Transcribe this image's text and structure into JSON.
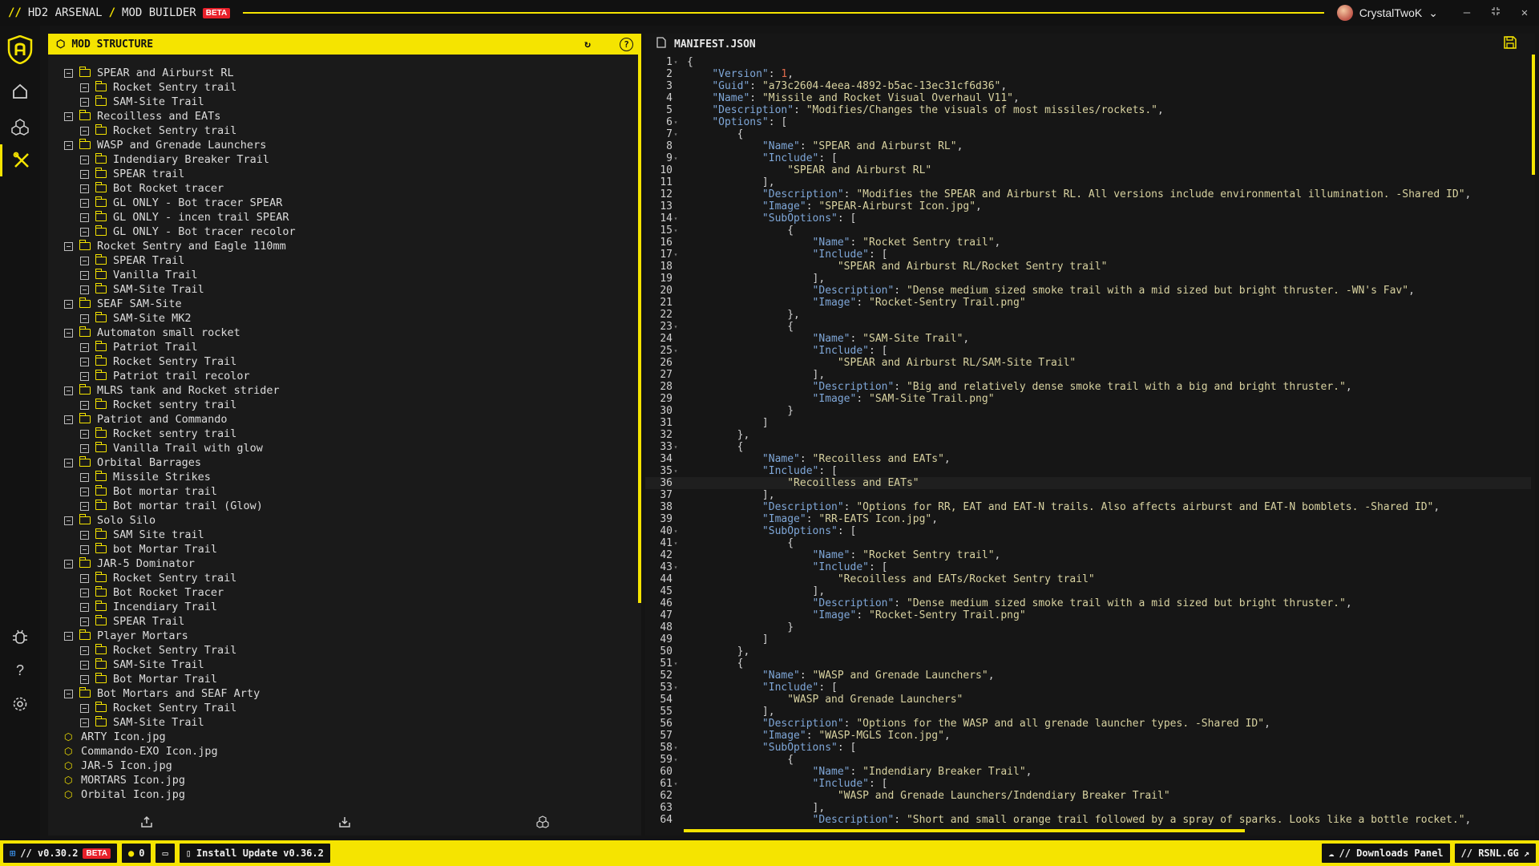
{
  "titlebar": {
    "app_name": "HD2 ARSENAL",
    "section": "MOD BUILDER",
    "beta": "BETA",
    "user": "CrystalTwoK"
  },
  "structure": {
    "title": "MOD STRUCTURE",
    "rows": [
      {
        "level": 0,
        "type": "folder",
        "label": "SPEAR and Airburst RL"
      },
      {
        "level": 1,
        "type": "item",
        "label": "Rocket Sentry trail"
      },
      {
        "level": 1,
        "type": "item",
        "label": "SAM-Site Trail"
      },
      {
        "level": 0,
        "type": "folder",
        "label": "Recoilless and EATs"
      },
      {
        "level": 1,
        "type": "item",
        "label": "Rocket Sentry trail"
      },
      {
        "level": 0,
        "type": "folder",
        "label": "WASP and Grenade Launchers"
      },
      {
        "level": 1,
        "type": "item",
        "label": "Indendiary Breaker Trail"
      },
      {
        "level": 1,
        "type": "item",
        "label": "SPEAR trail"
      },
      {
        "level": 1,
        "type": "item",
        "label": "Bot Rocket tracer"
      },
      {
        "level": 1,
        "type": "item",
        "label": "GL ONLY - Bot tracer SPEAR"
      },
      {
        "level": 1,
        "type": "item",
        "label": "GL ONLY - incen trail SPEAR"
      },
      {
        "level": 1,
        "type": "item",
        "label": "GL ONLY - Bot tracer recolor"
      },
      {
        "level": 0,
        "type": "folder",
        "label": "Rocket Sentry and Eagle 110mm"
      },
      {
        "level": 1,
        "type": "item",
        "label": "SPEAR Trail"
      },
      {
        "level": 1,
        "type": "item",
        "label": "Vanilla Trail"
      },
      {
        "level": 1,
        "type": "item",
        "label": "SAM-Site Trail"
      },
      {
        "level": 0,
        "type": "folder",
        "label": "SEAF SAM-Site"
      },
      {
        "level": 1,
        "type": "item",
        "label": "SAM-Site MK2"
      },
      {
        "level": 0,
        "type": "folder",
        "label": "Automaton small rocket"
      },
      {
        "level": 1,
        "type": "item",
        "label": "Patriot Trail"
      },
      {
        "level": 1,
        "type": "item",
        "label": "Rocket Sentry Trail"
      },
      {
        "level": 1,
        "type": "item",
        "label": "Patriot trail recolor"
      },
      {
        "level": 0,
        "type": "folder",
        "label": "MLRS tank and Rocket strider"
      },
      {
        "level": 1,
        "type": "item",
        "label": "Rocket sentry trail"
      },
      {
        "level": 0,
        "type": "folder",
        "label": "Patriot and Commando"
      },
      {
        "level": 1,
        "type": "item",
        "label": "Rocket sentry trail"
      },
      {
        "level": 1,
        "type": "item",
        "label": "Vanilla Trail with glow"
      },
      {
        "level": 0,
        "type": "folder",
        "label": "Orbital Barrages"
      },
      {
        "level": 1,
        "type": "item",
        "label": "Missile Strikes"
      },
      {
        "level": 1,
        "type": "item",
        "label": "Bot mortar trail"
      },
      {
        "level": 1,
        "type": "item",
        "label": "Bot mortar trail (Glow)"
      },
      {
        "level": 0,
        "type": "folder",
        "label": "Solo Silo"
      },
      {
        "level": 1,
        "type": "item",
        "label": "SAM Site trail"
      },
      {
        "level": 1,
        "type": "item",
        "label": "bot Mortar Trail"
      },
      {
        "level": 0,
        "type": "folder",
        "label": "JAR-5 Dominator"
      },
      {
        "level": 1,
        "type": "item",
        "label": "Rocket Sentry trail"
      },
      {
        "level": 1,
        "type": "item",
        "label": "Bot Rocket Tracer"
      },
      {
        "level": 1,
        "type": "item",
        "label": "Incendiary Trail"
      },
      {
        "level": 1,
        "type": "item",
        "label": "SPEAR Trail"
      },
      {
        "level": 0,
        "type": "folder",
        "label": "Player Mortars"
      },
      {
        "level": 1,
        "type": "item",
        "label": "Rocket Sentry Trail"
      },
      {
        "level": 1,
        "type": "item",
        "label": "SAM-Site Trail"
      },
      {
        "level": 1,
        "type": "item",
        "label": "Bot Mortar Trail"
      },
      {
        "level": 0,
        "type": "folder",
        "label": "Bot Mortars and SEAF Arty"
      },
      {
        "level": 1,
        "type": "item",
        "label": "Rocket Sentry Trail"
      },
      {
        "level": 1,
        "type": "item",
        "label": "SAM-Site Trail"
      },
      {
        "level": 0,
        "type": "file",
        "label": "ARTY Icon.jpg"
      },
      {
        "level": 0,
        "type": "file",
        "label": "Commando-EXO Icon.jpg"
      },
      {
        "level": 0,
        "type": "file",
        "label": "JAR-5 Icon.jpg"
      },
      {
        "level": 0,
        "type": "file",
        "label": "MORTARS Icon.jpg"
      },
      {
        "level": 0,
        "type": "file",
        "label": "Orbital Icon.jpg"
      }
    ]
  },
  "editor": {
    "filename": "MANIFEST.JSON",
    "current_line": 36,
    "lines": [
      [
        1,
        "{",
        true
      ],
      [
        2,
        "    \"Version\": 1,",
        false
      ],
      [
        3,
        "    \"Guid\": \"a73c2604-4eea-4892-b5ac-13ec31cf6d36\",",
        false
      ],
      [
        4,
        "    \"Name\": \"Missile and Rocket Visual Overhaul V11\",",
        false
      ],
      [
        5,
        "    \"Description\": \"Modifies/Changes the visuals of most missiles/rockets.\",",
        false
      ],
      [
        6,
        "    \"Options\": [",
        true
      ],
      [
        7,
        "        {",
        true
      ],
      [
        8,
        "            \"Name\": \"SPEAR and Airburst RL\",",
        false
      ],
      [
        9,
        "            \"Include\": [",
        true
      ],
      [
        10,
        "                \"SPEAR and Airburst RL\"",
        false
      ],
      [
        11,
        "            ],",
        false
      ],
      [
        12,
        "            \"Description\": \"Modifies the SPEAR and Airburst RL. All versions include environmental illumination. -Shared ID\",",
        false
      ],
      [
        13,
        "            \"Image\": \"SPEAR-Airburst Icon.jpg\",",
        false
      ],
      [
        14,
        "            \"SubOptions\": [",
        true
      ],
      [
        15,
        "                {",
        true
      ],
      [
        16,
        "                    \"Name\": \"Rocket Sentry trail\",",
        false
      ],
      [
        17,
        "                    \"Include\": [",
        true
      ],
      [
        18,
        "                        \"SPEAR and Airburst RL/Rocket Sentry trail\"",
        false
      ],
      [
        19,
        "                    ],",
        false
      ],
      [
        20,
        "                    \"Description\": \"Dense medium sized smoke trail with a mid sized but bright thruster. -WN's Fav\",",
        false
      ],
      [
        21,
        "                    \"Image\": \"Rocket-Sentry Trail.png\"",
        false
      ],
      [
        22,
        "                },",
        false
      ],
      [
        23,
        "                {",
        true
      ],
      [
        24,
        "                    \"Name\": \"SAM-Site Trail\",",
        false
      ],
      [
        25,
        "                    \"Include\": [",
        true
      ],
      [
        26,
        "                        \"SPEAR and Airburst RL/SAM-Site Trail\"",
        false
      ],
      [
        27,
        "                    ],",
        false
      ],
      [
        28,
        "                    \"Description\": \"Big and relatively dense smoke trail with a big and bright thruster.\",",
        false
      ],
      [
        29,
        "                    \"Image\": \"SAM-Site Trail.png\"",
        false
      ],
      [
        30,
        "                }",
        false
      ],
      [
        31,
        "            ]",
        false
      ],
      [
        32,
        "        },",
        false
      ],
      [
        33,
        "        {",
        true
      ],
      [
        34,
        "            \"Name\": \"Recoilless and EATs\",",
        false
      ],
      [
        35,
        "            \"Include\": [",
        true
      ],
      [
        36,
        "                \"Recoilless and EATs\"",
        false
      ],
      [
        37,
        "            ],",
        false
      ],
      [
        38,
        "            \"Description\": \"Options for RR, EAT and EAT-N trails. Also affects airburst and EAT-N bomblets. -Shared ID\",",
        false
      ],
      [
        39,
        "            \"Image\": \"RR-EATS Icon.jpg\",",
        false
      ],
      [
        40,
        "            \"SubOptions\": [",
        true
      ],
      [
        41,
        "                {",
        true
      ],
      [
        42,
        "                    \"Name\": \"Rocket Sentry trail\",",
        false
      ],
      [
        43,
        "                    \"Include\": [",
        true
      ],
      [
        44,
        "                        \"Recoilless and EATs/Rocket Sentry trail\"",
        false
      ],
      [
        45,
        "                    ],",
        false
      ],
      [
        46,
        "                    \"Description\": \"Dense medium sized smoke trail with a mid sized but bright thruster.\",",
        false
      ],
      [
        47,
        "                    \"Image\": \"Rocket-Sentry Trail.png\"",
        false
      ],
      [
        48,
        "                }",
        false
      ],
      [
        49,
        "            ]",
        false
      ],
      [
        50,
        "        },",
        false
      ],
      [
        51,
        "        {",
        true
      ],
      [
        52,
        "            \"Name\": \"WASP and Grenade Launchers\",",
        false
      ],
      [
        53,
        "            \"Include\": [",
        true
      ],
      [
        54,
        "                \"WASP and Grenade Launchers\"",
        false
      ],
      [
        55,
        "            ],",
        false
      ],
      [
        56,
        "            \"Description\": \"Options for the WASP and all grenade launcher types. -Shared ID\",",
        false
      ],
      [
        57,
        "            \"Image\": \"WASP-MGLS Icon.jpg\",",
        false
      ],
      [
        58,
        "            \"SubOptions\": [",
        true
      ],
      [
        59,
        "                {",
        true
      ],
      [
        60,
        "                    \"Name\": \"Indendiary Breaker Trail\",",
        false
      ],
      [
        61,
        "                    \"Include\": [",
        true
      ],
      [
        62,
        "                        \"WASP and Grenade Launchers/Indendiary Breaker Trail\"",
        false
      ],
      [
        63,
        "                    ],",
        false
      ],
      [
        64,
        "                    \"Description\": \"Short and small orange trail followed by a spray of sparks. Looks like a bottle rocket.\",",
        false
      ]
    ]
  },
  "statusbar": {
    "version": "// v0.30.2",
    "beta": "BETA",
    "count": "0",
    "update": "Install Update v0.36.2",
    "downloads": "// Downloads Panel",
    "site": "// RSNL.GG"
  },
  "colors": {
    "accent": "#f5e400",
    "beta_badge": "#e8202a",
    "json_key": "#7fa7d8",
    "json_string": "#d8d2a0",
    "json_number": "#e06c4c"
  }
}
